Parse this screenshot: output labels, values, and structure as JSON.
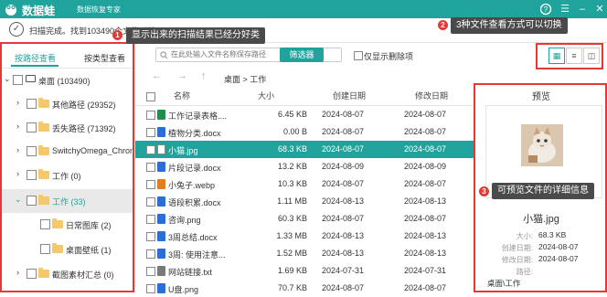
{
  "app": {
    "name": "数据蛙",
    "slogan": "数据恢复专家",
    "brand_color": "#1fa39c",
    "annotation_color": "#e53935"
  },
  "status": {
    "message": "扫描完成。找到103490个文件（共",
    "icon": "check-circle-icon"
  },
  "left_tabs": {
    "by_path": "按路径查看",
    "by_type": "按类型查看"
  },
  "tree": [
    {
      "label": "桌面 (103490)"
    },
    {
      "label": "其他路径 (29352)"
    },
    {
      "label": "丢失路径 (71392)"
    },
    {
      "label": "SwitchyOmega_Chromium"
    },
    {
      "label": "工作 (0)"
    },
    {
      "label": "工作 (33)"
    },
    {
      "label": "日常图库 (2)"
    },
    {
      "label": "桌面壁纸 (1)"
    },
    {
      "label": "截图素材汇总 (0)"
    }
  ],
  "toolbar": {
    "search_placeholder": "在此处输入文件名称保存路径",
    "filter_label": "筛选器",
    "show_deleted_label": "仅显示删除项"
  },
  "breadcrumb": "桌面 > 工作",
  "table": {
    "headers": {
      "name": "名称",
      "size": "大小",
      "created": "创建日期",
      "modified": "修改日期"
    },
    "rows": [
      {
        "name": "工作记录表格....",
        "size": "6.45 KB",
        "created": "2024-08-07",
        "modified": "2024-08-07",
        "type": "xlsx"
      },
      {
        "name": "植物分类.docx",
        "size": "0.00 B",
        "created": "2024-08-07",
        "modified": "2024-08-07",
        "type": "docx"
      },
      {
        "name": "小猫.jpg",
        "size": "68.3 KB",
        "created": "2024-08-07",
        "modified": "2024-08-07",
        "type": "jpg"
      },
      {
        "name": "片段记录.docx",
        "size": "13.2 KB",
        "created": "2024-08-09",
        "modified": "2024-08-09",
        "type": "docx"
      },
      {
        "name": "小兔子.webp",
        "size": "10.3 KB",
        "created": "2024-08-07",
        "modified": "2024-08-07",
        "type": "webp"
      },
      {
        "name": "语段积累.docx",
        "size": "1.11 MB",
        "created": "2024-08-13",
        "modified": "2024-08-13",
        "type": "docx"
      },
      {
        "name": "咨询.png",
        "size": "60.3 KB",
        "created": "2024-08-07",
        "modified": "2024-08-07",
        "type": "png"
      },
      {
        "name": "3周总结.docx",
        "size": "1.33 MB",
        "created": "2024-08-13",
        "modified": "2024-08-13",
        "type": "docx"
      },
      {
        "name": "3周: 使用注意...",
        "size": "1.52 MB",
        "created": "2024-08-13",
        "modified": "2024-08-13",
        "type": "docx"
      },
      {
        "name": "网站链接.txt",
        "size": "1.69 KB",
        "created": "2024-07-31",
        "modified": "2024-07-31",
        "type": "txt"
      },
      {
        "name": "U盘.png",
        "size": "70.7 KB",
        "created": "2024-08-07",
        "modified": "2024-08-07",
        "type": "png"
      }
    ]
  },
  "preview": {
    "title": "预览",
    "file_name": "小猫.jpg",
    "details": [
      {
        "key": "大小:",
        "value": "68.3 KB"
      },
      {
        "key": "创建日期:",
        "value": "2024-08-07"
      },
      {
        "key": "修改日期:",
        "value": "2024-08-07"
      },
      {
        "key": "路径:",
        "value": "桌面\\工作"
      }
    ]
  },
  "annotations": [
    {
      "num": "1",
      "text": "显示出来的扫描结果已经分好类"
    },
    {
      "num": "2",
      "text": "3种文件查看方式可以切换"
    },
    {
      "num": "3",
      "text": "可预览文件的详细信息"
    }
  ]
}
